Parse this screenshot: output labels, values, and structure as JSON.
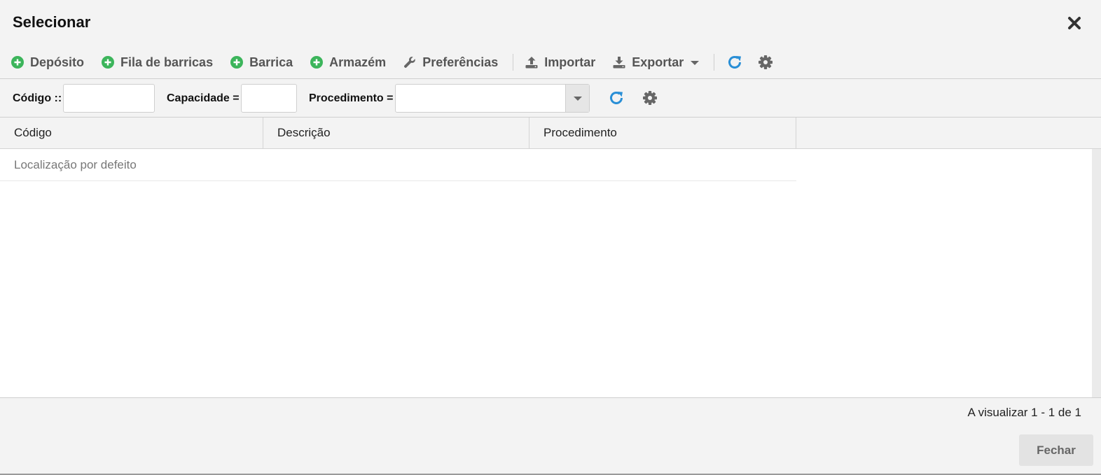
{
  "dialog": {
    "title": "Selecionar"
  },
  "toolbar": {
    "items": [
      {
        "label": "Depósito",
        "icon": "plus-circle-icon"
      },
      {
        "label": "Fila de barricas",
        "icon": "plus-circle-icon"
      },
      {
        "label": "Barrica",
        "icon": "plus-circle-icon"
      },
      {
        "label": "Armazém",
        "icon": "plus-circle-icon"
      },
      {
        "label": "Preferências",
        "icon": "wrench-icon"
      }
    ],
    "import_label": "Importar",
    "export_label": "Exportar"
  },
  "filters": {
    "code_label": "Código ::",
    "code_value": "",
    "capacity_label": "Capacidade =",
    "capacity_value": "",
    "procedure_label": "Procedimento =",
    "procedure_value": ""
  },
  "table": {
    "columns": [
      "Código",
      "Descrição",
      "Procedimento"
    ],
    "rows": [
      {
        "code": "Localização por defeito",
        "description": "",
        "procedure": ""
      }
    ]
  },
  "footer": {
    "pager_text": "A visualizar 1 - 1 de 1",
    "close_label": "Fechar"
  },
  "colors": {
    "add_green": "#3cb55b",
    "refresh_blue": "#2a8fd6",
    "icon_gray": "#666666",
    "background": "#f3f3f3"
  }
}
